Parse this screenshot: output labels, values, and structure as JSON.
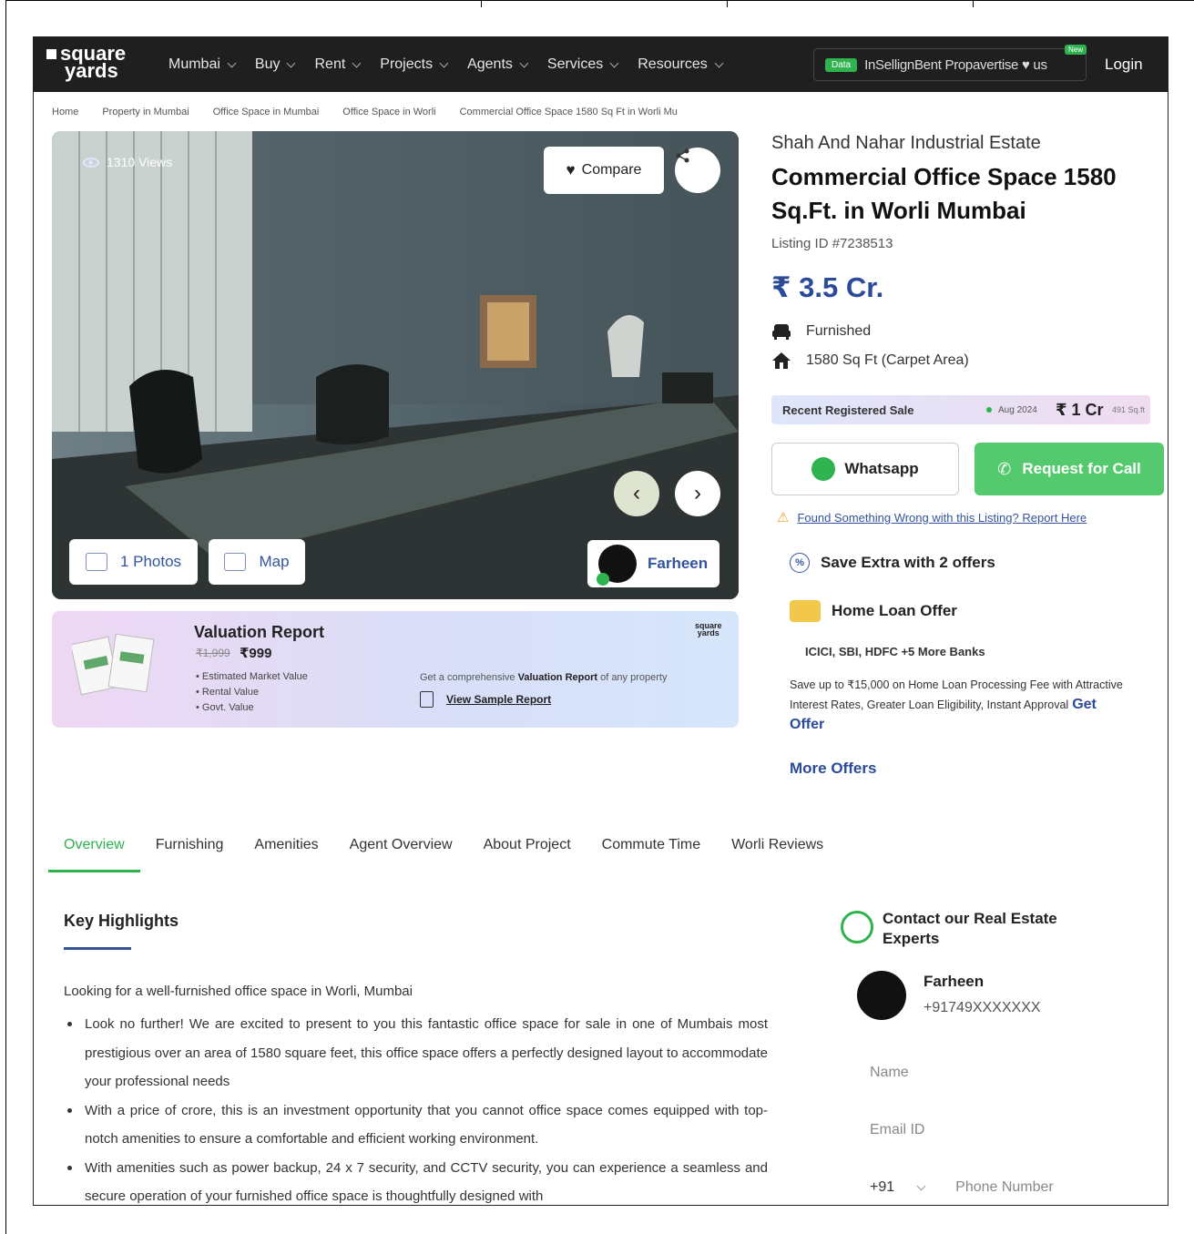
{
  "header": {
    "logo_line1": "square",
    "logo_line2": "yards",
    "nav": [
      {
        "label": "Mumbai"
      },
      {
        "label": "Buy"
      },
      {
        "label": "Rent"
      },
      {
        "label": "Projects"
      },
      {
        "label": "Agents"
      },
      {
        "label": "Services"
      },
      {
        "label": "Resources"
      }
    ],
    "data_badge": "Data",
    "right_text": "InSellignBent Propavertise ♥ us",
    "new_badge": "New",
    "login": "Login"
  },
  "breadcrumb": [
    "Home",
    "Property in Mumbai",
    "Office Space in Mumbai",
    "Office Space in Worli",
    "Commercial Office Space 1580 Sq Ft in Worli Mu"
  ],
  "gallery": {
    "views": "1310 Views",
    "compare": "Compare",
    "photos": "1 Photos",
    "map": "Map",
    "agent": "Farheen"
  },
  "valuation": {
    "title": "Valuation Report",
    "old_price": "₹1,999",
    "new_price": "₹999",
    "items": [
      "Estimated Market Value",
      "Rental Value",
      "Govt. Value"
    ],
    "logo_line1": "square",
    "logo_line2": "yards",
    "cta_prefix": "Get a comprehensive ",
    "cta_bold": "Valuation Report",
    "cta_suffix": " of any property",
    "sample": "View Sample Report"
  },
  "listing": {
    "project": "Shah And Nahar Industrial Estate",
    "title": "Commercial Office Space 1580 Sq.Ft. in Worli Mumbai",
    "listing_id": "Listing ID #7238513",
    "price": "₹ 3.5 Cr.",
    "furnishing": "Furnished",
    "area": "1580 Sq Ft  (Carpet Area)",
    "recent_sale_label": "Recent Registered Sale",
    "recent_sale_date": "Aug 2024",
    "recent_sale_price": "₹ 1 Cr",
    "recent_sale_area": "491 Sq.ft",
    "whatsapp": "Whatsapp",
    "request_call": "Request for Call",
    "report": "Found Something Wrong with this Listing? Report Here"
  },
  "offers": {
    "title": "Save Extra with 2 offers",
    "loan_title": "Home Loan Offer",
    "banks": "ICICI, SBI, HDFC +5 More Banks",
    "desc": "Save up to ₹15,000 on Home Loan Processing Fee with Attractive Interest Rates, Greater Loan Eligibility, Instant Approval",
    "get_offer": "Get Offer",
    "more": "More Offers"
  },
  "tabs": [
    "Overview",
    "Furnishing",
    "Amenities",
    "Agent Overview",
    "About Project",
    "Commute Time",
    "Worli Reviews"
  ],
  "highlights": {
    "title": "Key Highlights",
    "intro": "Looking for a well-furnished office space in Worli, Mumbai",
    "bullets": [
      "Look no further! We are excited to present to you this fantastic office space for sale in one of Mumbais most prestigious over an area of 1580 square feet, this office space offers a perfectly designed layout to accommodate your professional needs",
      "With a price of crore, this is an investment opportunity that you cannot office space comes equipped with top-notch amenities to ensure a comfortable and efficient working environment.",
      "With amenities such as power backup, 24 x 7 security, and CCTV security, you can experience a seamless and secure operation of your furnished office space is thoughtfully designed with"
    ]
  },
  "contact": {
    "title": "Contact our Real Estate Experts",
    "name": "Farheen",
    "phone": "+91749XXXXXXX",
    "name_placeholder": "Name",
    "email_placeholder": "Email ID",
    "code": "+91",
    "phone_placeholder": "Phone Number"
  },
  "colors": {
    "nav_bg": "#1f1f1f",
    "brand_blue": "#2b4a97",
    "green": "#2fb34f",
    "call_green": "#54c96d"
  }
}
